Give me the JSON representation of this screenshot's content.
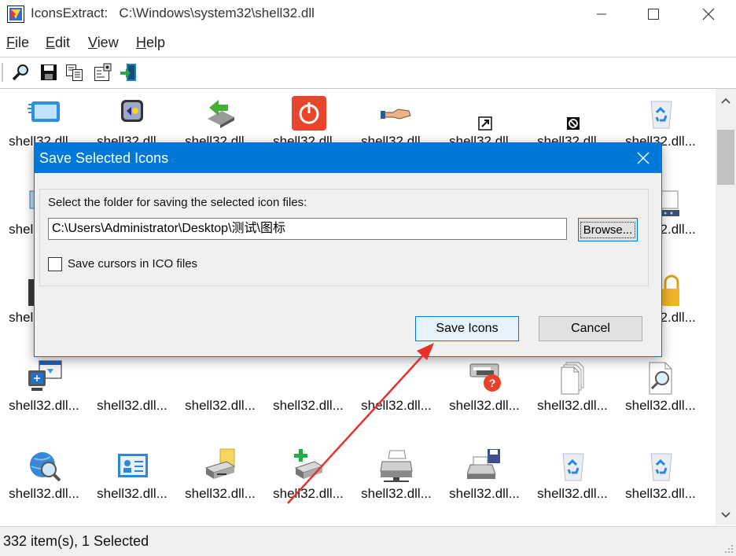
{
  "window": {
    "title": "IconsExtract:   C:\\Windows\\system32\\shell32.dll"
  },
  "menu": {
    "file": {
      "first": "F",
      "rest": "ile"
    },
    "edit": {
      "first": "E",
      "rest": "dit"
    },
    "view": {
      "first": "V",
      "rest": "iew"
    },
    "help": {
      "first": "H",
      "rest": "elp"
    }
  },
  "toolbar": {
    "icons": [
      "search-icon",
      "save-icon",
      "copy-icon",
      "properties-icon",
      "exit-icon"
    ]
  },
  "list": {
    "item_label": "shell32.dll...",
    "rows": [
      [
        "monitor-blue",
        "speaker",
        "usb-arrow",
        "power-red",
        "handshake",
        "shortcut-arrow",
        "shortcut-noentry",
        "recycle-bin"
      ],
      [
        "network",
        "",
        "",
        "",
        "",
        "",
        "",
        "monitor-strip"
      ],
      [
        "camera",
        "",
        "",
        "",
        "",
        "",
        "",
        "lock"
      ],
      [
        "network-pc",
        "",
        "",
        "",
        "",
        "printer-help",
        "documents",
        "search-doc"
      ],
      [
        "globe-search",
        "control-panel",
        "printer-folder",
        "printer-add",
        "printer-network",
        "printer-save",
        "recycle-empty",
        "recycle-full"
      ]
    ]
  },
  "status": {
    "text": "332 item(s), 1 Selected"
  },
  "dialog": {
    "title": "Save Selected Icons",
    "prompt": "Select the folder for saving the selected icon files:",
    "path": "C:\\Users\\Administrator\\Desktop\\测试\\图标",
    "browse_label": "Browse...",
    "checkbox_label": "Save cursors in ICO files",
    "checkbox_checked": false,
    "save_label": "Save Icons",
    "cancel_label": "Cancel"
  },
  "colors": {
    "dialog_title_bg": "#0078d7",
    "arrow": "#e8312b"
  }
}
